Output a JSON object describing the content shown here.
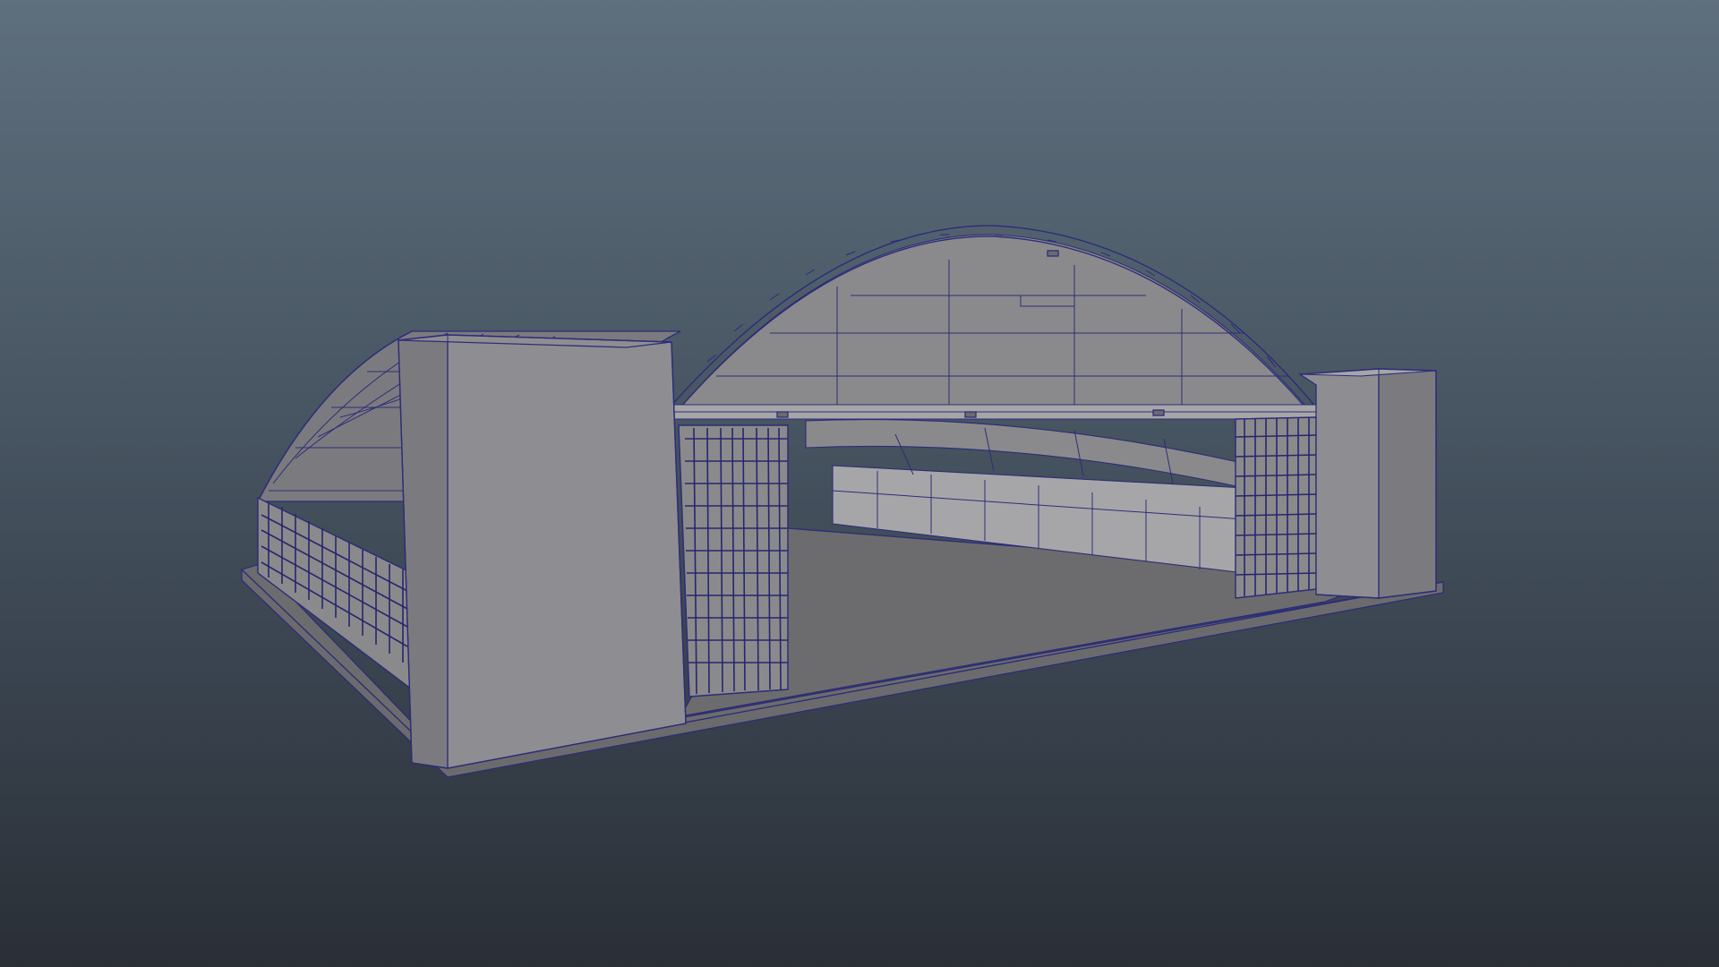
{
  "viewport": {
    "background_top": "#5e6f7d",
    "background_bottom": "#2a2f36",
    "wireframe_color": "#2d2d78",
    "shading_color": "#8a8a8c"
  },
  "scene": {
    "object": "hangar-model",
    "display_mode": "wireframe-on-shaded"
  }
}
